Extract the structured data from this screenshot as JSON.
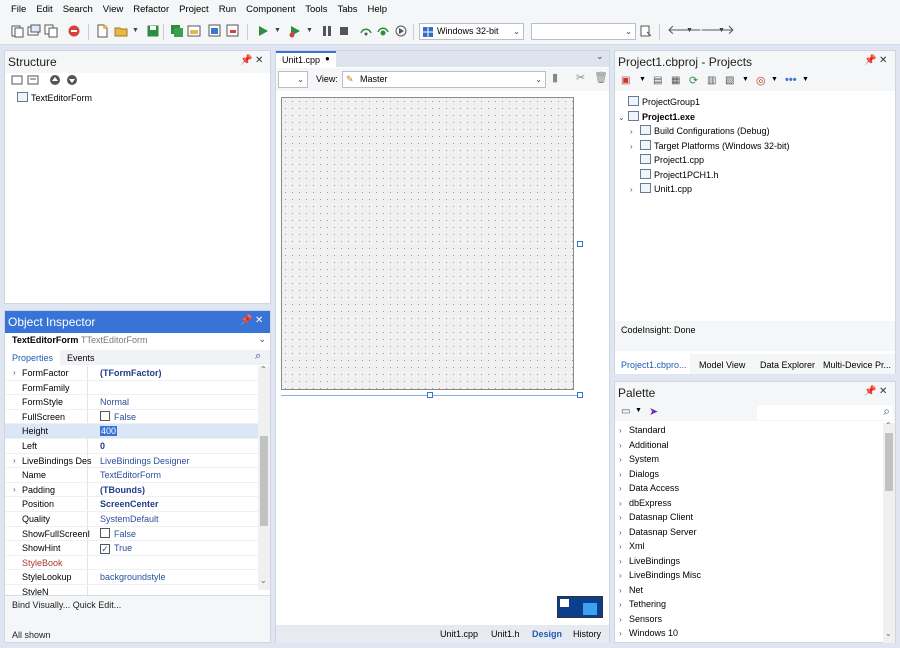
{
  "menu": [
    "File",
    "Edit",
    "Search",
    "View",
    "Refactor",
    "Project",
    "Run",
    "Component",
    "Tools",
    "Tabs",
    "Help"
  ],
  "toolbar": {
    "platform": "Windows 32-bit",
    "config": ""
  },
  "structure": {
    "title": "Structure",
    "root": "TextEditorForm"
  },
  "inspector": {
    "title": "Object Inspector",
    "object_name": "TextEditorForm",
    "object_type": "TTextEditorForm",
    "tab_properties": "Properties",
    "tab_events": "Events",
    "rows": [
      {
        "name": "FormFactor",
        "value": "(TFormFactor)",
        "expand": true,
        "bold": true
      },
      {
        "name": "FormFamily",
        "value": ""
      },
      {
        "name": "FormStyle",
        "value": "Normal"
      },
      {
        "name": "FullScreen",
        "value": "False",
        "check": "off"
      },
      {
        "name": "Height",
        "value": "400",
        "selected": true
      },
      {
        "name": "Left",
        "value": "0",
        "bold": true
      },
      {
        "name": "LiveBindings Des",
        "value": "LiveBindings Designer",
        "expand": true
      },
      {
        "name": "Name",
        "value": "TextEditorForm"
      },
      {
        "name": "Padding",
        "value": "(TBounds)",
        "expand": true,
        "bold": true
      },
      {
        "name": "Position",
        "value": "ScreenCenter",
        "bold": true
      },
      {
        "name": "Quality",
        "value": "SystemDefault"
      },
      {
        "name": "ShowFullScreenI",
        "value": "False",
        "check": "off"
      },
      {
        "name": "ShowHint",
        "value": "True",
        "check": "on"
      },
      {
        "name": "StyleBook",
        "value": "",
        "red": true
      },
      {
        "name": "StyleLookup",
        "value": "backgroundstyle"
      },
      {
        "name": "StyleN",
        "value": ""
      }
    ],
    "actions": "Bind Visually... Quick Edit...",
    "status": "All shown"
  },
  "editor": {
    "tab": "Unit1.cpp",
    "view_label": "View:",
    "view_value": "Master",
    "bottom_tabs": [
      "Unit1.cpp",
      "Unit1.h",
      "Design",
      "History"
    ]
  },
  "projects": {
    "title": "Project1.cbproj - Projects",
    "items": [
      {
        "label": "ProjectGroup1",
        "level": 0
      },
      {
        "label": "Project1.exe",
        "level": 0,
        "bold": true,
        "chev": "v"
      },
      {
        "label": "Build Configurations (Debug)",
        "level": 1,
        "chev": ">"
      },
      {
        "label": "Target Platforms (Windows 32-bit)",
        "level": 1,
        "chev": ">"
      },
      {
        "label": "Project1.cpp",
        "level": 1
      },
      {
        "label": "Project1PCH1.h",
        "level": 1
      },
      {
        "label": "Unit1.cpp",
        "level": 1,
        "chev": ">"
      }
    ],
    "status": "CodeInsight: Done",
    "tabs": [
      "Project1.cbpro...",
      "Model View",
      "Data Explorer",
      "Multi-Device Pr..."
    ]
  },
  "palette": {
    "title": "Palette",
    "items": [
      "Standard",
      "Additional",
      "System",
      "Dialogs",
      "Data Access",
      "dbExpress",
      "Datasnap Client",
      "Datasnap Server",
      "Xml",
      "LiveBindings",
      "LiveBindings Misc",
      "Net",
      "Tethering",
      "Sensors",
      "Windows 10"
    ]
  }
}
